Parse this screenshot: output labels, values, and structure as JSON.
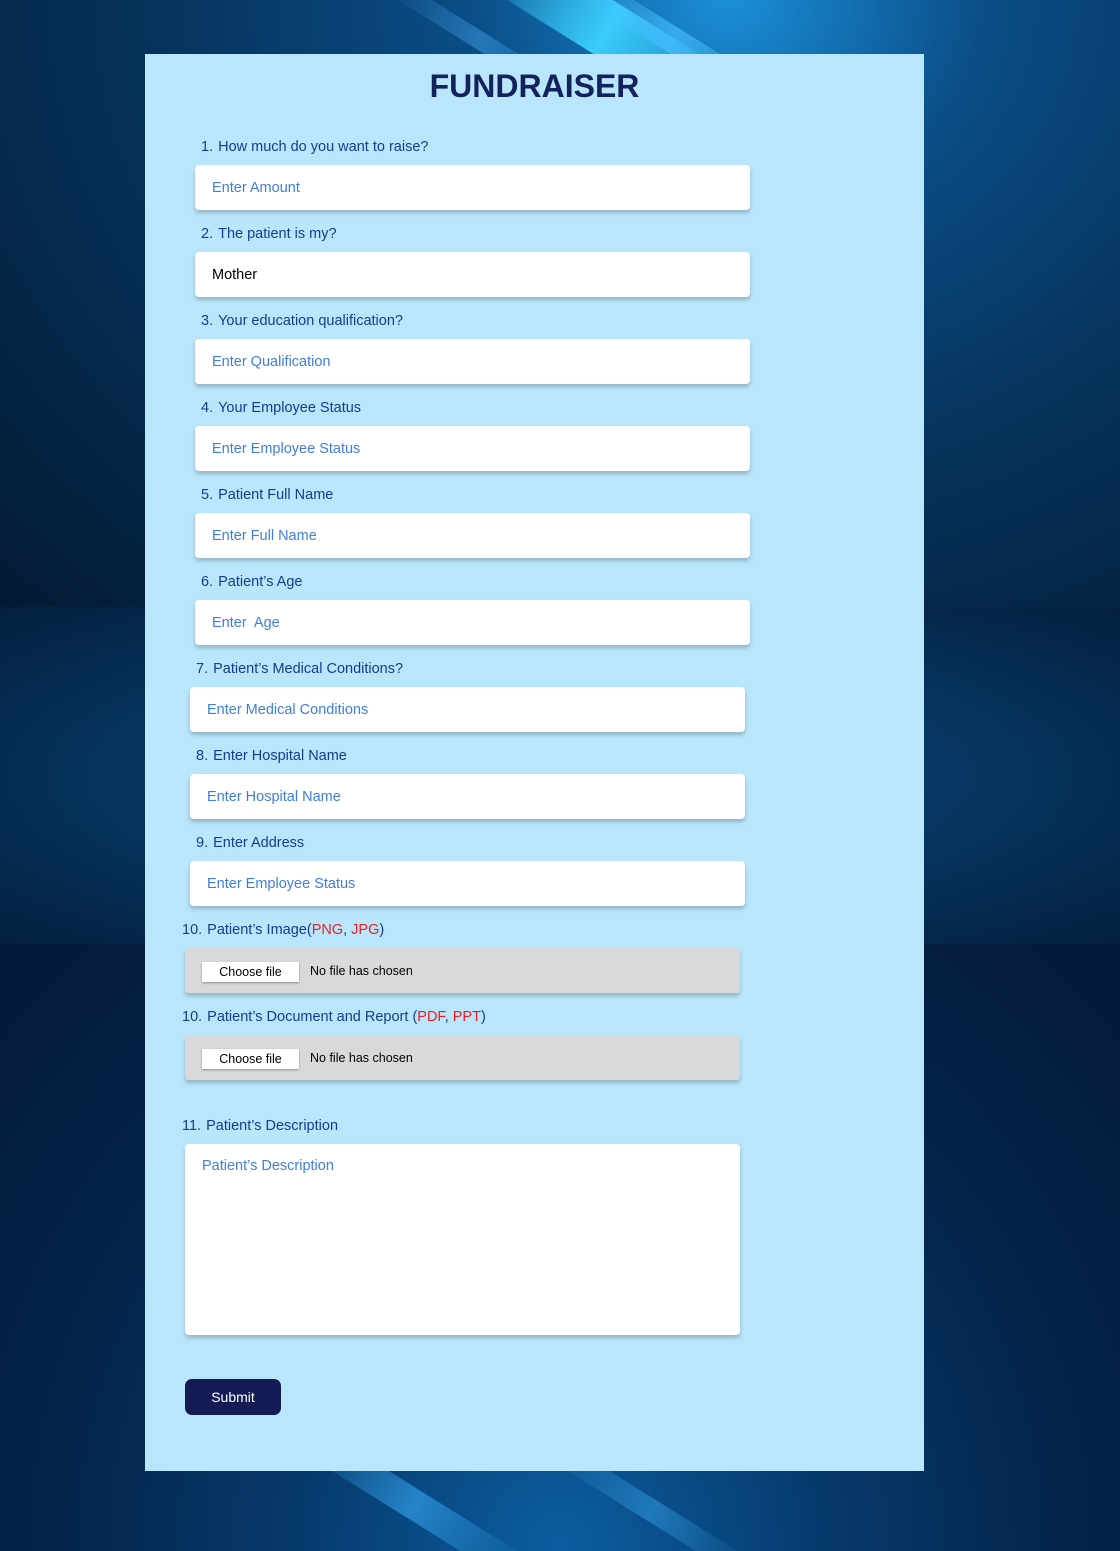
{
  "form": {
    "title": "FUNDRAISER",
    "questions": [
      {
        "num": "1.",
        "label": "How much do you want to raise?",
        "placeholder": "Enter Amount",
        "value": ""
      },
      {
        "num": "2.",
        "label": "The patient is my?",
        "placeholder": "",
        "value": "Mother"
      },
      {
        "num": "3.",
        "label": "Your education qualification?",
        "placeholder": "Enter Qualification",
        "value": ""
      },
      {
        "num": "4.",
        "label": "Your Employee Status",
        "placeholder": "Enter Employee Status",
        "value": ""
      },
      {
        "num": "5.",
        "label": "Patient Full Name",
        "placeholder": "Enter Full Name",
        "value": ""
      },
      {
        "num": "6.",
        "label": "Patient’s Age",
        "placeholder": "Enter  Age",
        "value": ""
      },
      {
        "num": "7.",
        "label": "Patient’s Medical Conditions?",
        "placeholder": "Enter Medical Conditions",
        "value": ""
      },
      {
        "num": "8.",
        "label": "Enter Hospital Name",
        "placeholder": "Enter Hospital Name",
        "value": ""
      },
      {
        "num": "9.",
        "label": "Enter Address",
        "placeholder": "Enter Employee Status",
        "value": ""
      }
    ],
    "image_upload": {
      "num": "10.",
      "label": "Patient’s Image(",
      "ext1": "PNG",
      "sep": ", ",
      "ext2": "JPG",
      "close": ")",
      "button_label": "Choose file",
      "status": "No file has chosen"
    },
    "document_upload": {
      "num": "10.",
      "label": "Patient’s Document and Report (",
      "ext1": "PDF",
      "sep": ", ",
      "ext2": "PPT",
      "close": ")",
      "button_label": "Choose file",
      "status": "No file has chosen"
    },
    "description": {
      "num": "11.",
      "label": "Patient’s Description",
      "placeholder": "Patient’s Description"
    },
    "submit_label": "Submit"
  },
  "colors": {
    "panel": "#bae6fc",
    "title": "#13215c",
    "label": "#163c8f",
    "placeholder": "#3f7de0",
    "extension": "#ee1c25",
    "submit": "#131c54"
  }
}
